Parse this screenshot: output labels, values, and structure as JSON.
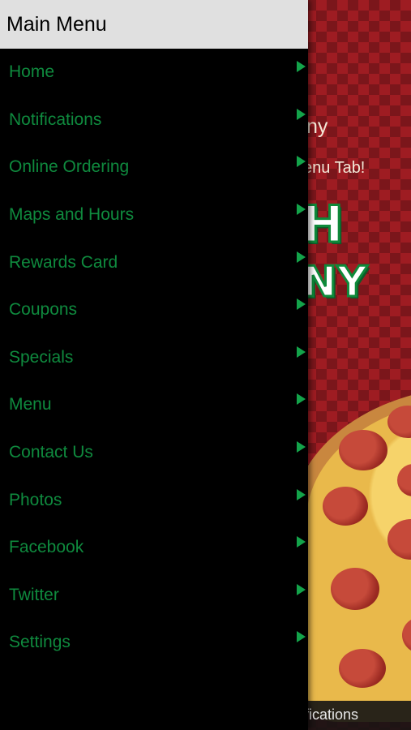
{
  "background": {
    "line1": "ny",
    "line2": "enu Tab!",
    "logo_line1": "H",
    "logo_line2": "NY",
    "bottom_text": "fications"
  },
  "drawer": {
    "title": "Main Menu",
    "arrow_icon": "triangle-right-icon",
    "items": [
      {
        "label": "Home"
      },
      {
        "label": "Notifications"
      },
      {
        "label": "Online Ordering"
      },
      {
        "label": "Maps and Hours"
      },
      {
        "label": "Rewards Card"
      },
      {
        "label": "Coupons"
      },
      {
        "label": "Specials"
      },
      {
        "label": "Menu"
      },
      {
        "label": "Contact Us"
      },
      {
        "label": "Photos"
      },
      {
        "label": "Facebook"
      },
      {
        "label": "Twitter"
      },
      {
        "label": "Settings"
      }
    ]
  },
  "colors": {
    "menu_text": "#0f8a3e",
    "arrow": "#13a34a",
    "header_bg": "#e0e0e0",
    "drawer_bg": "#000000",
    "checker_red": "#9e1c22"
  }
}
